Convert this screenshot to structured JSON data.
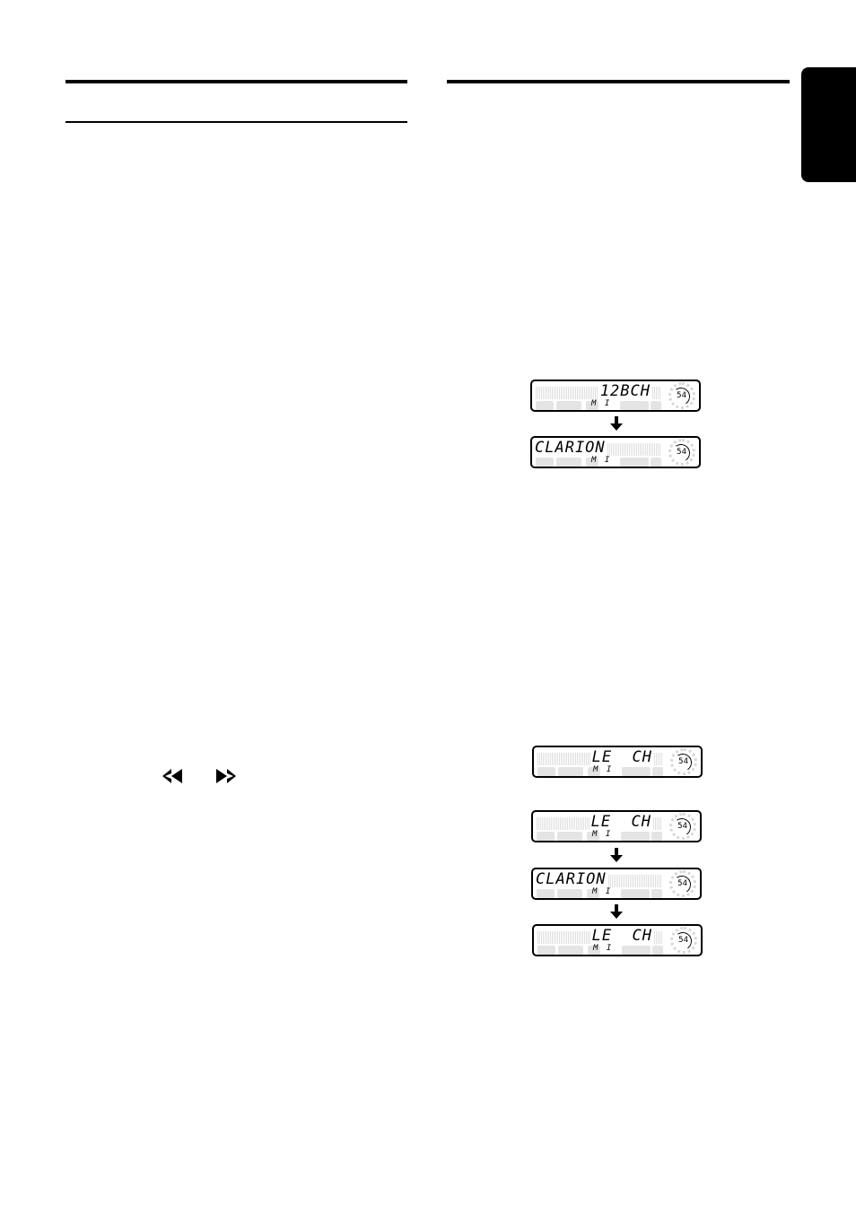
{
  "page": {
    "side_tab": {
      "label": ""
    },
    "left_column": {
      "transport_icons": [
        {
          "name": "rewind-icon",
          "glyph": "<<"
        },
        {
          "name": "fast-forward-icon",
          "glyph": ">>"
        }
      ]
    },
    "displays": {
      "group1": [
        {
          "main": "12BCH",
          "align": "right",
          "sub": "M I",
          "dial": "54"
        },
        {
          "main": "CLARION",
          "align": "left",
          "sub": "M I",
          "dial": "54"
        }
      ],
      "group2_single": {
        "main": "LE  CH",
        "align": "right",
        "sub": "M I",
        "dial": "54"
      },
      "group3": [
        {
          "main": "LE  CH",
          "align": "right",
          "sub": "M I",
          "dial": "54"
        },
        {
          "main": "CLARION",
          "align": "left",
          "sub": "M I",
          "dial": "54"
        },
        {
          "main": "LE  CH",
          "align": "right",
          "sub": "M I",
          "dial": "54"
        }
      ]
    }
  }
}
